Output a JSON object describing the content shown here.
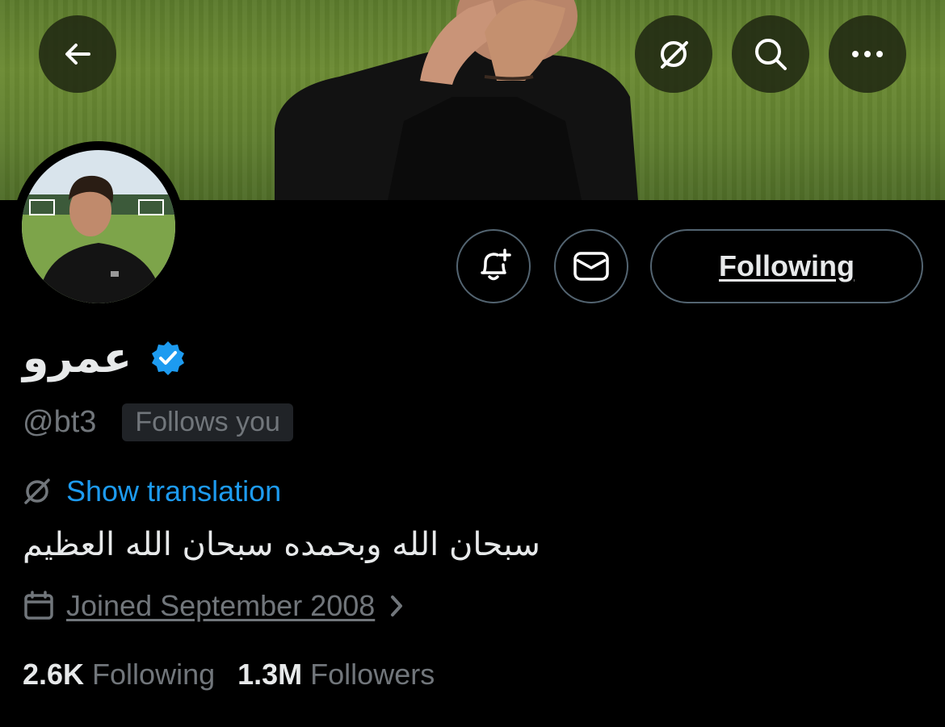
{
  "colors": {
    "accent": "#1d9bf0",
    "verified": "#1d9bf0",
    "muted": "#71767b",
    "text": "#e7e9ea",
    "background": "#000000",
    "border": "#536471"
  },
  "header": {
    "icons": {
      "back": "arrow-left-icon",
      "translate": "translate-icon",
      "search": "search-icon",
      "more": "more-horizontal-icon"
    }
  },
  "actions": {
    "notify_icon": "bell-plus-icon",
    "message_icon": "envelope-icon",
    "following_label": "Following"
  },
  "profile": {
    "display_name": "عمرو",
    "verified_icon": "verified-badge-icon",
    "handle": "@bt3",
    "follows_you": "Follows you",
    "translate_label": "Show translation",
    "bio": "سبحان الله وبحمده سبحان الله العظيم",
    "joined": "Joined September 2008",
    "following_count": "2.6K",
    "following_label": "Following",
    "followers_count": "1.3M",
    "followers_label": "Followers"
  }
}
